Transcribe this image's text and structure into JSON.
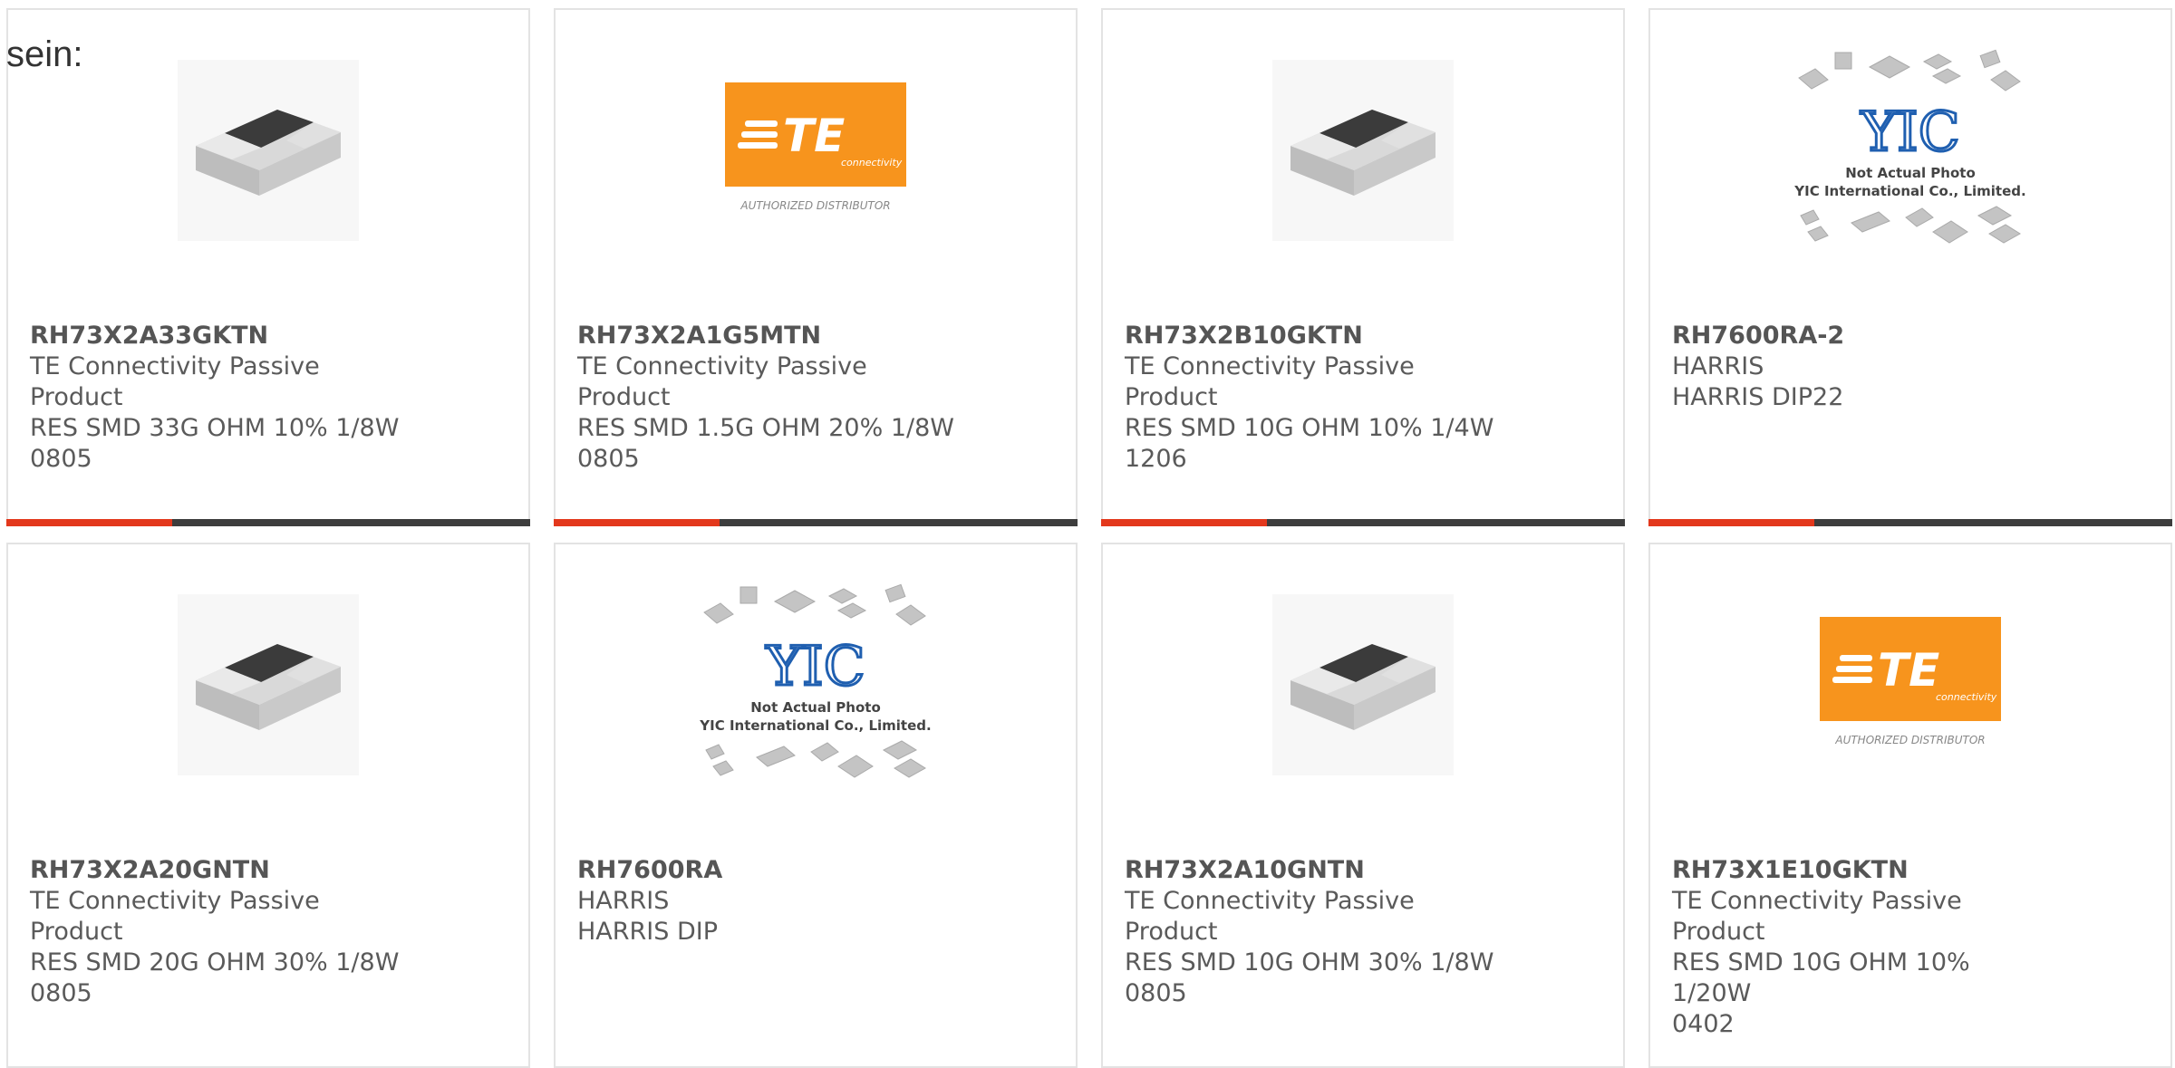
{
  "lead_text": "sein:",
  "colors": {
    "accent_red": "#e3381c",
    "bar_dark": "#3d3d3d",
    "te_orange": "#f7941d",
    "yic_blue": "#1f5fb0"
  },
  "products": [
    {
      "pn": "RH73X2A33GKTN",
      "mfr": "TE Connectivity Passive Product",
      "desc1": "RES SMD 33G OHM 10% 1/8W",
      "desc2": "0805",
      "image": "resistor-chip"
    },
    {
      "pn": "RH73X2A1G5MTN",
      "mfr": "TE Connectivity Passive Product",
      "desc1": "RES SMD 1.5G OHM 20% 1/8W",
      "desc2": "0805",
      "image": "te-logo"
    },
    {
      "pn": "RH73X2B10GKTN",
      "mfr": "TE Connectivity Passive Product",
      "desc1": "RES SMD 10G OHM 10% 1/4W",
      "desc2": "1206",
      "image": "resistor-chip"
    },
    {
      "pn": "RH7600RA-2",
      "mfr": "HARRIS",
      "desc1": "HARRIS DIP22",
      "desc2": "",
      "image": "yic-placeholder"
    },
    {
      "pn": "RH73X2A20GNTN",
      "mfr": "TE Connectivity Passive Product",
      "desc1": "RES SMD 20G OHM 30% 1/8W",
      "desc2": "0805",
      "image": "resistor-chip"
    },
    {
      "pn": "RH7600RA",
      "mfr": "HARRIS",
      "desc1": "HARRIS DIP",
      "desc2": "",
      "image": "yic-placeholder"
    },
    {
      "pn": "RH73X2A10GNTN",
      "mfr": "TE Connectivity Passive Product",
      "desc1": "RES SMD 10G OHM 30% 1/8W",
      "desc2": "0805",
      "image": "resistor-chip"
    },
    {
      "pn": "RH73X1E10GKTN",
      "mfr": "TE Connectivity Passive Product",
      "desc1": "RES SMD 10G OHM 10% 1/20W",
      "desc2": "0402",
      "image": "te-logo"
    }
  ],
  "te_logo": {
    "brand": "TE",
    "sub": "connectivity",
    "caption": "AUTHORIZED DISTRIBUTOR"
  },
  "yic_placeholder": {
    "brand": "YIC",
    "line1": "Not Actual Photo",
    "line2": "YIC International Co., Limited."
  }
}
